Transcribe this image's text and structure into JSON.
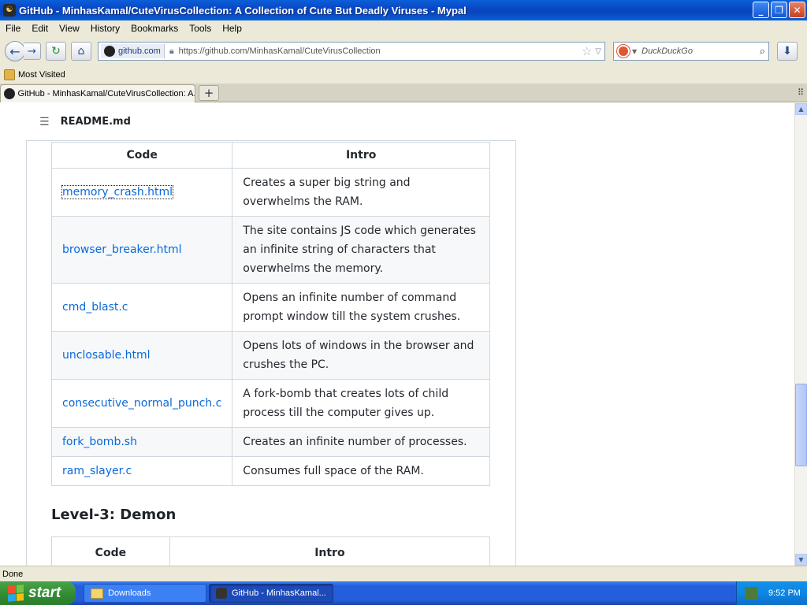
{
  "window": {
    "title": "GitHub - MinhasKamal/CuteVirusCollection: A Collection of Cute But Deadly Viruses - Mypal",
    "controls": {
      "minimize": "_",
      "maximize": "❐",
      "close": "✕"
    }
  },
  "menu": [
    "File",
    "Edit",
    "View",
    "History",
    "Bookmarks",
    "Tools",
    "Help"
  ],
  "nav": {
    "site_badge": "github.com",
    "url": "https://github.com/MinhasKamal/CuteVirusCollection",
    "search_placeholder": "DuckDuckGo"
  },
  "bookmarks": {
    "most_visited": "Most Visited"
  },
  "tabs": {
    "active_title": "GitHub - MinhasKamal/CuteVirusCollection: A..."
  },
  "readme": {
    "title": "README.md",
    "table1": {
      "headers": [
        "Code",
        "Intro"
      ],
      "rows": [
        {
          "code": "memory_crash.html",
          "intro": "Creates a super big string and overwhelms the RAM."
        },
        {
          "code": "browser_breaker.html",
          "intro": "The site contains JS code which generates an infinite string of characters that overwhelms the memory."
        },
        {
          "code": "cmd_blast.c",
          "intro": "Opens an infinite number of command prompt window till the system crushes."
        },
        {
          "code": "unclosable.html",
          "intro": "Opens lots of windows in the browser and crushes the PC."
        },
        {
          "code": "consecutive_normal_punch.c",
          "intro": "A fork-bomb that creates lots of child process till the computer gives up."
        },
        {
          "code": "fork_bomb.sh",
          "intro": "Creates an infinite number of processes."
        },
        {
          "code": "ram_slayer.c",
          "intro": "Consumes full space of the RAM."
        }
      ]
    },
    "level3_heading": "Level-3: Demon",
    "table2": {
      "headers": [
        "Code",
        "Intro"
      ]
    }
  },
  "status": {
    "text": "Done"
  },
  "taskbar": {
    "start": "start",
    "tasks": [
      "Downloads",
      "GitHub - MinhasKamal..."
    ],
    "clock": "9:52 PM"
  }
}
